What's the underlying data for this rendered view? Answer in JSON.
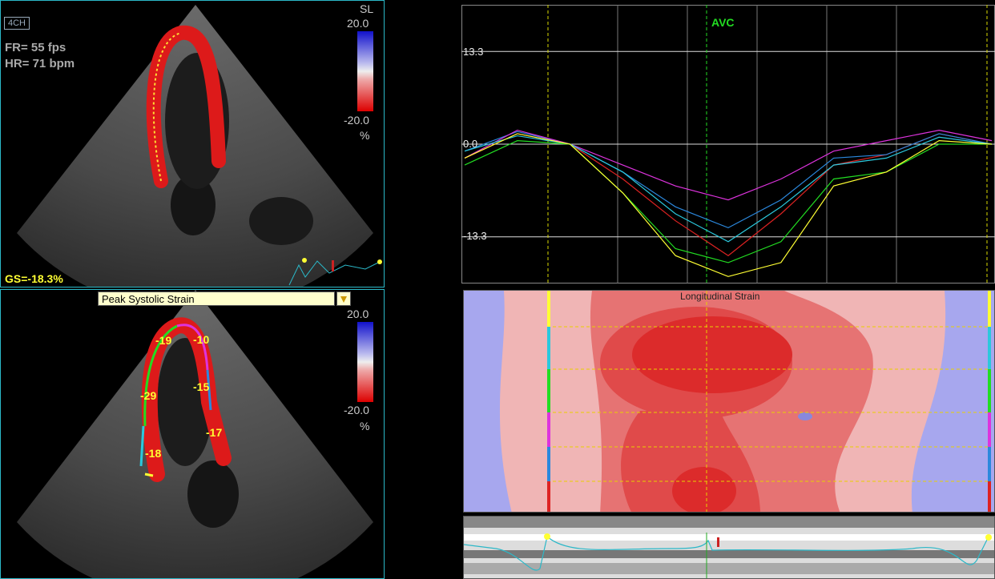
{
  "top_echo": {
    "view": "4CH",
    "frame_rate": "FR= 55 fps",
    "heart_rate": "HR= 71 bpm",
    "scale_name": "SL",
    "scale_max": "20.0",
    "scale_min": "-20.0",
    "scale_unit": "%",
    "global_strain": "GS=-18.3%"
  },
  "bottom_echo": {
    "parameter": "Peak Systolic Strain",
    "scale_max": "20.0",
    "scale_min": "-20.0",
    "scale_unit": "%",
    "segments": [
      "-19",
      "-10",
      "-29",
      "-15",
      "-17",
      "-18"
    ]
  },
  "strain_curves": {
    "ticks": [
      "13.3",
      "0.0",
      "-13.3"
    ],
    "marker": "AVC"
  },
  "strain_map": {
    "title": "Longitudinal Strain"
  },
  "colors": {
    "border": "#2bb8c8",
    "label_yellow": "#ffff33",
    "avc_green": "#22dd22"
  },
  "chart_data": {
    "type": "line",
    "xlabel": "",
    "ylabel": "",
    "ylim": [
      -20,
      20
    ],
    "yticks": [
      13.3,
      0.0,
      -13.3
    ],
    "x": [
      0,
      10,
      20,
      30,
      40,
      50,
      60,
      70,
      80,
      90,
      100
    ],
    "series": [
      {
        "values": [
          -2,
          1.5,
          0,
          -5,
          -11,
          -16,
          -10,
          -3,
          -1.5,
          1.5,
          0
        ]
      },
      {
        "values": [
          -1,
          1.8,
          0,
          -4,
          -9,
          -12,
          -8,
          -2,
          -1.5,
          1.5,
          0
        ]
      },
      {
        "values": [
          -2,
          2,
          0,
          -3,
          -6,
          -8,
          -5,
          -1,
          0.5,
          2,
          0.5
        ]
      },
      {
        "values": [
          -1,
          1.2,
          0,
          -4,
          -10,
          -14,
          -9,
          -3,
          -2,
          1,
          0
        ]
      },
      {
        "values": [
          -3,
          0.5,
          0,
          -7,
          -15,
          -17,
          -14,
          -5,
          -4,
          0,
          0
        ]
      },
      {
        "values": [
          -2,
          1.5,
          0,
          -7,
          -16,
          -19,
          -17,
          -6,
          -4,
          0.5,
          0
        ]
      }
    ]
  }
}
